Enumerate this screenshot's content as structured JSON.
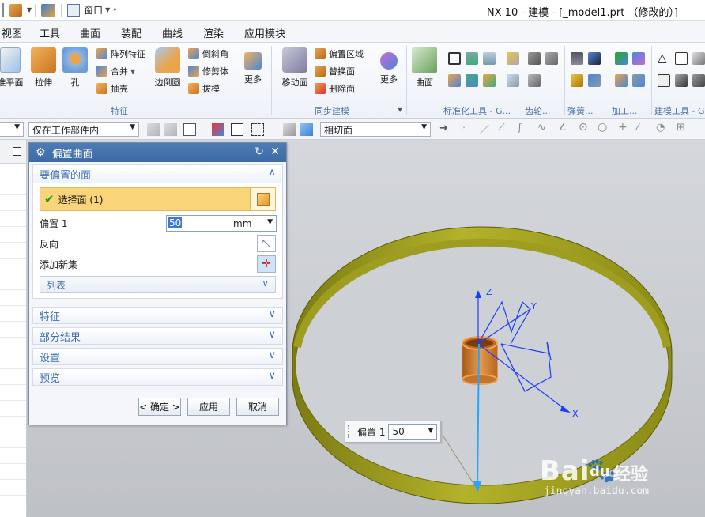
{
  "titlebar": {
    "window_menu": "窗口",
    "title": "NX 10 - 建模 - [_model1.prt （修改的）]"
  },
  "menu_tabs": [
    "视图",
    "工具",
    "曲面",
    "装配",
    "曲线",
    "渲染",
    "应用模块"
  ],
  "ribbon": {
    "datum_plane": "准平面",
    "extrude": "拉伸",
    "hole": "孔",
    "pattern_feature": "阵列特征",
    "unite": "合并",
    "shell": "抽壳",
    "edge_blend": "边倒圆",
    "chamfer": "倒斜角",
    "trim_body": "修剪体",
    "draft": "拔模",
    "more_feature": "更多",
    "group_feature": "特征",
    "move_face": "移动面",
    "offset_region": "偏置区域",
    "replace_face": "替换面",
    "delete_face": "删除面",
    "more_sync": "更多",
    "group_sync": "同步建模",
    "surface": "曲面",
    "group_std": "标准化工具 - G...",
    "group_gear": "齿轮...",
    "group_spring": "弹簧...",
    "group_machining": "加工...",
    "group_build": "建模工具 - G"
  },
  "selection_bar": {
    "scope": "仅在工作部件内",
    "snap": "相切面"
  },
  "dialog": {
    "title": "偏置曲面",
    "section_faces": "要偏置的面",
    "select_face": "选择面 (1)",
    "offset_label": "偏置 1",
    "offset_value": "50",
    "offset_unit": "mm",
    "reverse_label": "反向",
    "add_set_label": "添加新集",
    "list_label": "列表",
    "collapsed": [
      "特征",
      "部分结果",
      "设置",
      "预览"
    ],
    "ok": "< 确定 >",
    "apply": "应用",
    "cancel": "取消"
  },
  "dynamic_input": {
    "label": "偏置 1",
    "value": "50"
  },
  "axes": {
    "x": "X",
    "y": "Y",
    "z": "Z"
  },
  "watermark": {
    "brand": "Bai",
    "brand2": "du",
    "suffix": "经验",
    "url": "jingyan.baidu.com"
  },
  "colors": {
    "ring": "#9a9a1e",
    "cylinder": "#d9873a",
    "csys": "#1a3cff",
    "dialog_title": "#3c6aa5",
    "selected_row": "#fad478"
  }
}
